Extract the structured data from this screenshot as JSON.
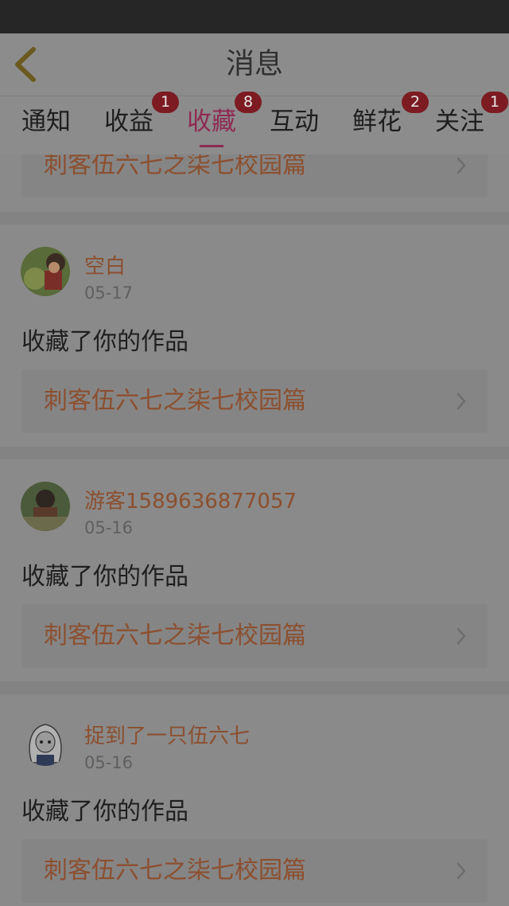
{
  "header": {
    "title": "消息"
  },
  "tabs": [
    {
      "label": "通知",
      "badge": ""
    },
    {
      "label": "收益",
      "badge": "1"
    },
    {
      "label": "收藏",
      "badge": "8"
    },
    {
      "label": "互动",
      "badge": ""
    },
    {
      "label": "鲜花",
      "badge": "2"
    },
    {
      "label": "关注",
      "badge": "1"
    }
  ],
  "active_tab": "收藏",
  "top_partial_work": "刺客伍六七之柒七校园篇",
  "messages": [
    {
      "user": "空白",
      "date": "05-17",
      "action": "收藏了你的作品",
      "work": "刺客伍六七之柒七校园篇"
    },
    {
      "user": "游客1589636877057",
      "date": "05-16",
      "action": "收藏了你的作品",
      "work": "刺客伍六七之柒七校园篇"
    },
    {
      "user": "捉到了一只伍六七",
      "date": "05-16",
      "action": "收藏了你的作品",
      "work": "刺客伍六七之柒七校园篇"
    }
  ],
  "colors": {
    "active_tab": "#8e2a52",
    "badge": "#7c1b22",
    "link_text": "#8c4f2f"
  }
}
